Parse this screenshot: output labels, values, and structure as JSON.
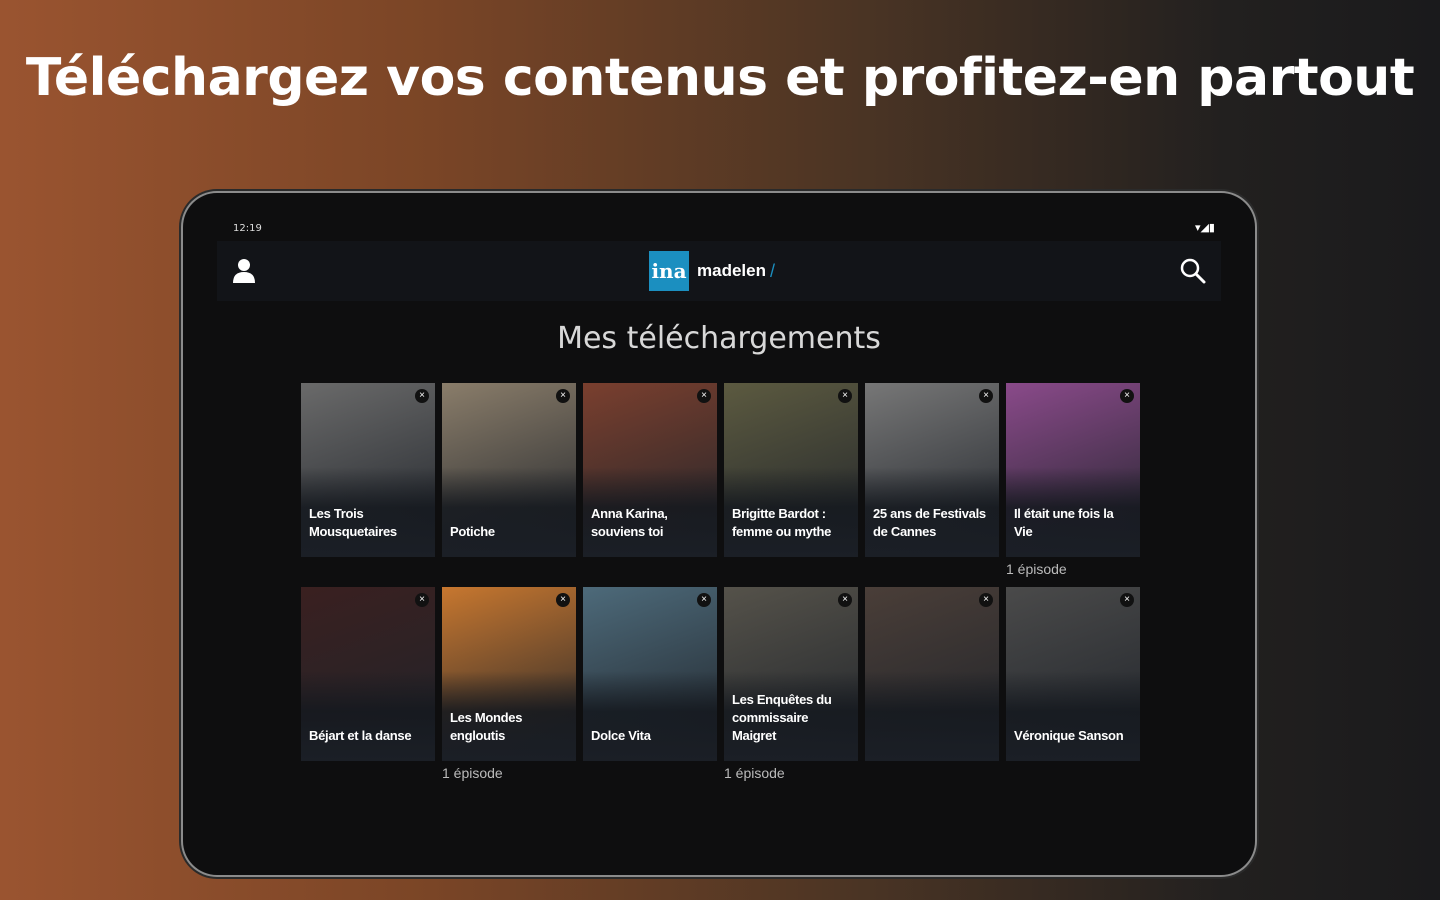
{
  "headline": "Téléchargez vos contenus et profitez-en partout",
  "device": {
    "time": "12:19",
    "status_icons": "▾◢▮"
  },
  "appbar": {
    "logo_mark": "ina",
    "logo_text": "madelen",
    "logo_slash": "/"
  },
  "page_title": "Mes téléchargements",
  "close_glyph": "×",
  "rows": [
    [
      {
        "title": "Les Trois Mousquetaires",
        "subtitle": "",
        "episodes": "",
        "color": "#6a6a6a"
      },
      {
        "title": "Potiche",
        "subtitle": "",
        "episodes": "",
        "color": "#8a7d6a"
      },
      {
        "title": "Anna Karina, souviens toi",
        "subtitle": "",
        "episodes": "",
        "color": "#7a3f2e"
      },
      {
        "title": "Brigitte Bardot : femme ou mythe",
        "subtitle": "",
        "episodes": "",
        "color": "#5c5a40"
      },
      {
        "title": "25 ans de Festivals de Cannes",
        "subtitle": "",
        "episodes": "",
        "color": "#777777"
      },
      {
        "title": "Il était une fois la Vie",
        "subtitle": "",
        "episodes": "1 épisode",
        "color": "#8a4a8a"
      }
    ],
    [
      {
        "title": "Béjart et la danse",
        "subtitle": "",
        "episodes": "",
        "color": "#3a2020"
      },
      {
        "title": "Les Mondes engloutis",
        "subtitle": "",
        "episodes": "1 épisode",
        "color": "#c7772f"
      },
      {
        "title": "Dolce Vita",
        "subtitle": "",
        "episodes": "",
        "color": "#4d6a7a"
      },
      {
        "title": "Les Enquêtes du commissaire Maigret",
        "subtitle": "",
        "episodes": "1 épisode",
        "color": "#55524a"
      },
      {
        "title": "",
        "subtitle": "",
        "episodes": "",
        "color": "#4a3e38"
      },
      {
        "title": "Véronique Sanson",
        "subtitle": "",
        "episodes": "",
        "color": "#4a4a4a"
      }
    ]
  ]
}
